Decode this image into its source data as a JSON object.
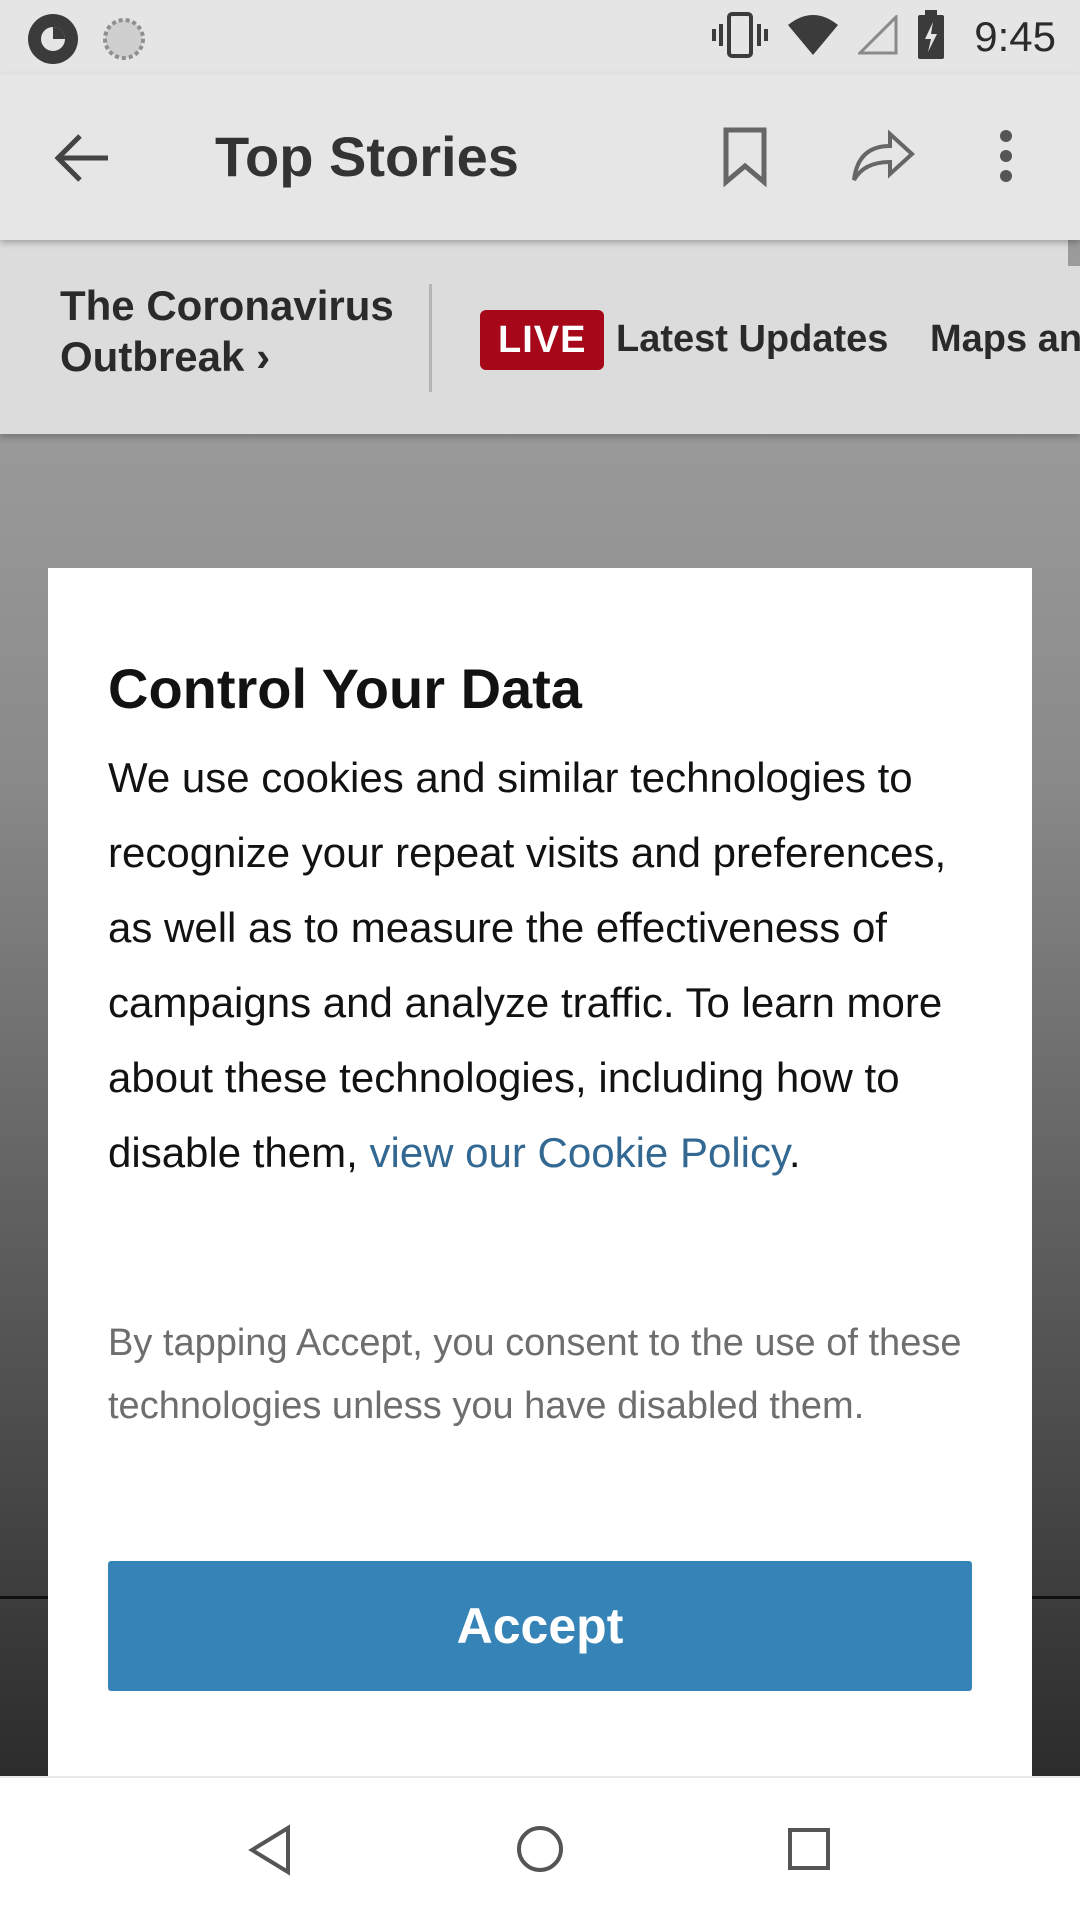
{
  "status_bar": {
    "time": "9:45",
    "icons": [
      "app-notification-icon",
      "sync-icon",
      "vibrate-icon",
      "wifi-icon",
      "cell-signal-icon",
      "battery-charging-icon"
    ]
  },
  "app_bar": {
    "title": "Top Stories",
    "icons": [
      "back-arrow-icon",
      "bookmark-icon",
      "share-icon",
      "more-options-icon"
    ]
  },
  "section_strip": {
    "title_line1": "The Coronavirus",
    "title_line2": "Outbreak",
    "title_chevron": "›",
    "live_badge": "LIVE",
    "latest_link": "Latest Updates",
    "maps_link": "Maps and"
  },
  "dialog": {
    "title": "Control Your Data",
    "body_text": "We use cookies and similar technologies to recognize your repeat visits and preferences, as well as to measure the effectiveness of campaigns and analyze traffic. To learn more about these technologies, including how to disable them, ",
    "cookie_link": "view our Cookie Policy",
    "body_end": ".",
    "consent_text": "By tapping Accept, you consent to the use of these technologies unless you have disabled them.",
    "accept_label": "Accept"
  },
  "colors": {
    "live_badge": "#a6081a",
    "link": "#326891",
    "accept_button": "#3684b7"
  },
  "nav_bar": {
    "icons": [
      "nav-back-icon",
      "nav-home-icon",
      "nav-recents-icon"
    ]
  }
}
